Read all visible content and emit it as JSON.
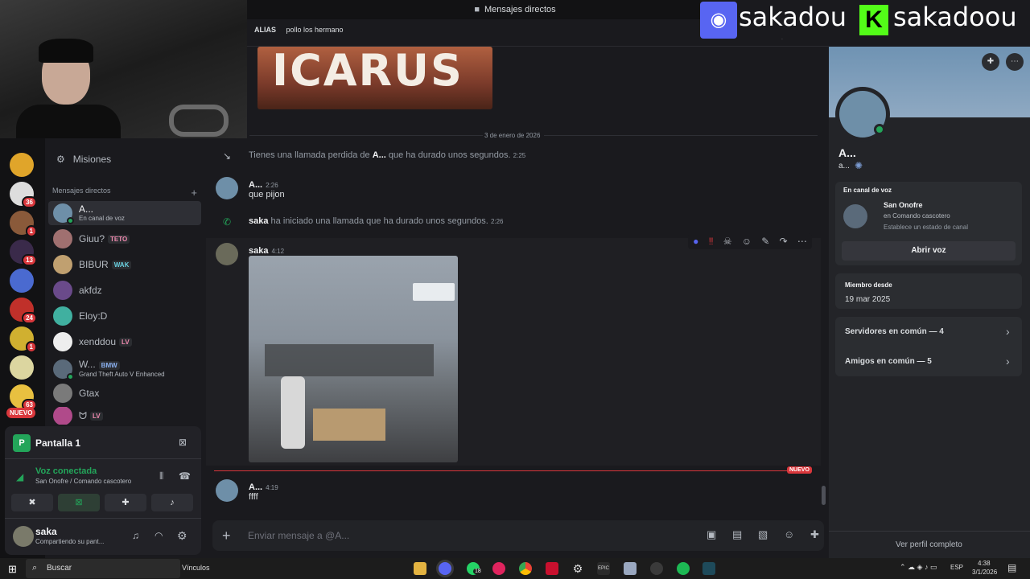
{
  "window": {
    "title": "Mensajes directos"
  },
  "alias": {
    "label": "ALIAS",
    "value": "pollo los hermano"
  },
  "overlay": {
    "discord_name": "sakadou",
    "kick_name": "sakadoou"
  },
  "servers": [
    {
      "badge": ""
    },
    {
      "badge": "36"
    },
    {
      "badge": "1"
    },
    {
      "badge": "13"
    },
    {
      "badge": "24"
    },
    {
      "badge": "1"
    },
    {
      "badge": ""
    },
    {
      "badge": "63"
    }
  ],
  "servers_new_label": "NUEVO",
  "sidebar": {
    "missions": "Misiones",
    "dm_header": "Mensajes directos",
    "dm_add": "+",
    "dms": [
      {
        "name": "A...",
        "sub": "En canal de voz",
        "tag": ""
      },
      {
        "name": "Giuu?",
        "sub": "",
        "tag": "TETO"
      },
      {
        "name": "BIBUR",
        "sub": "",
        "tag": "WAK"
      },
      {
        "name": "akfdz",
        "sub": "",
        "tag": ""
      },
      {
        "name": "Eloy:D",
        "sub": "",
        "tag": ""
      },
      {
        "name": "xenddou",
        "sub": "",
        "tag": "LV"
      },
      {
        "name": "W...",
        "sub": "Grand Theft Auto V Enhanced",
        "tag": "BMW"
      },
      {
        "name": "Gtax",
        "sub": "",
        "tag": ""
      },
      {
        "name": "",
        "sub": "",
        "tag": "LV"
      }
    ]
  },
  "panel": {
    "screen_title": "Pantalla 1",
    "voice_status": "Voz conectada",
    "voice_channel": "San Onofre / Comando cascotero",
    "user_name": "saka",
    "user_status": "Compartiendo su pant..."
  },
  "chat": {
    "image_title": "ICARUS",
    "date_divider": "3 de enero de 2026",
    "missed_call": {
      "prefix": "Tienes una llamada perdida de",
      "who": "A...",
      "suffix": "que ha durado unos segundos.",
      "time": "2:25"
    },
    "msg1": {
      "author": "A...",
      "time": "2:26",
      "text": "que pijon"
    },
    "call": {
      "who": "saka",
      "text": "ha iniciado una llamada que ha durado unos segundos.",
      "time": "2:26"
    },
    "msg2": {
      "author": "saka",
      "time": "4:12"
    },
    "new_label": "NUEVO",
    "msg3": {
      "author": "A...",
      "time": "4:19",
      "text": "ffff"
    },
    "input_placeholder": "Enviar mensaje a @A..."
  },
  "profile": {
    "name": "A...",
    "handle": "a...",
    "voice_card_title": "En canal de voz",
    "voice_server": "San Onofre",
    "voice_channel": "en Comando cascotero",
    "voice_status_hint": "Establece un estado de canal",
    "open_voice": "Abrir voz",
    "member_since_label": "Miembro desde",
    "member_since": "19 mar 2025",
    "servers_common": "Servidores en común — 4",
    "friends_common": "Amigos en común — 5",
    "full_profile": "Ver perfil completo"
  },
  "taskbar": {
    "search": "Buscar",
    "links": "Vínculos",
    "lang": "ESP",
    "time": "4:38",
    "date": "3/1/2026",
    "whatsapp_badge": "18"
  },
  "colors": {
    "accent": "#5865f2",
    "online": "#23a55a",
    "danger": "#da373c",
    "voice_green": "#23a55a"
  }
}
